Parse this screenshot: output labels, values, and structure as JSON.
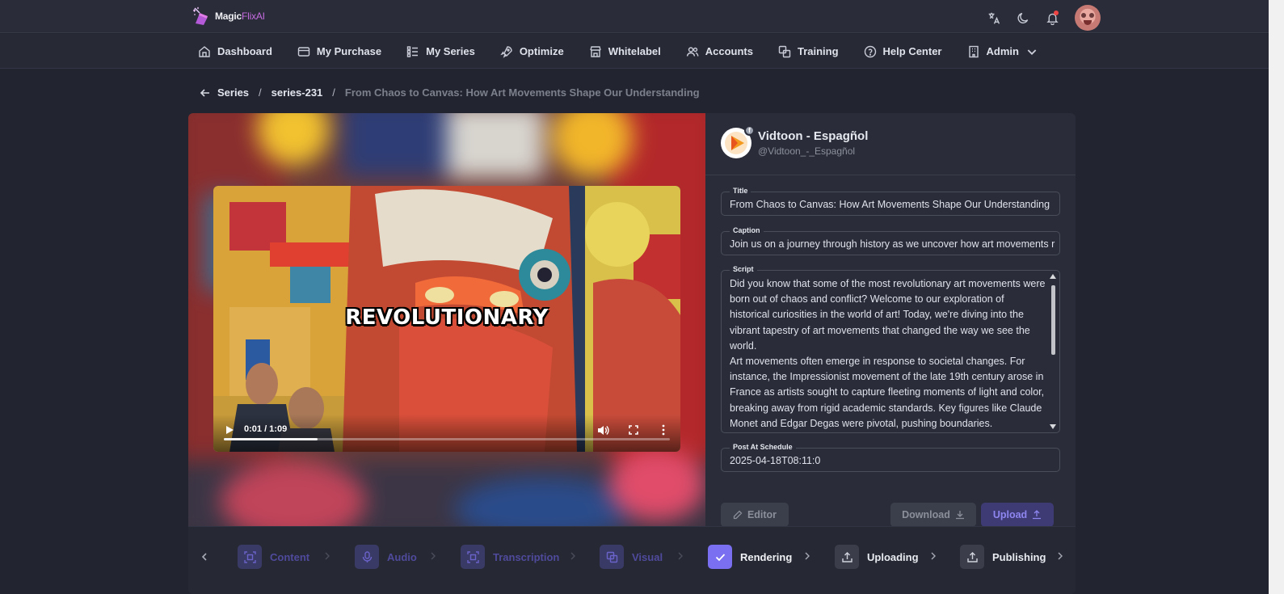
{
  "app": {
    "brand_prefix": "Magic",
    "brand_suffix": "FlixAI"
  },
  "nav": [
    {
      "label": "Dashboard",
      "icon": "home-icon"
    },
    {
      "label": "My Purchase",
      "icon": "credit-card-icon"
    },
    {
      "label": "My Series",
      "icon": "list-icon"
    },
    {
      "label": "Optimize",
      "icon": "rocket-icon"
    },
    {
      "label": "Whitelabel",
      "icon": "store-icon"
    },
    {
      "label": "Accounts",
      "icon": "users-icon"
    },
    {
      "label": "Training",
      "icon": "copy-icon"
    },
    {
      "label": "Help Center",
      "icon": "help-circle-icon"
    },
    {
      "label": "Admin",
      "icon": "building-icon"
    }
  ],
  "breadcrumb": {
    "root": "Series",
    "series": "series-231",
    "current": "From Chaos to Canvas: How Art Movements Shape Our Understanding"
  },
  "video": {
    "overlay_word": "REVOLUTIONARY",
    "time": "0:01 / 1:09",
    "progress": 0.21
  },
  "channel": {
    "name": "Vidtoon - Espagñol",
    "handle": "@Vidtoon_-_Espagñol"
  },
  "form": {
    "title_label": "Title",
    "title_value": "From Chaos to Canvas: How Art Movements Shape Our Understanding",
    "caption_label": "Caption",
    "caption_value": "Join us on a journey through history as we uncover how art movements r",
    "script_label": "Script",
    "script_value": "Did you know that some of the most revolutionary art movements were born out of chaos and conflict? Welcome to our exploration of historical curiosities in the world of art! Today, we're diving into the vibrant tapestry of art movements that changed the way we see the world.\nArt movements often emerge in response to societal changes. For instance, the Impressionist movement of the late 19th century arose in France as artists sought to capture fleeting moments of light and color, breaking away from rigid academic standards. Key figures like Claude Monet and Edgar Degas were pivotal, pushing boundaries.\nMonet focused on daily life, striving to capture the essence of a moment.",
    "schedule_label": "Post At Schedule",
    "schedule_value": "2025-04-18T08:11:0"
  },
  "buttons": {
    "editor": "Editor",
    "download": "Download",
    "upload": "Upload"
  },
  "steps": [
    {
      "label": "Content",
      "state": "done"
    },
    {
      "label": "Audio",
      "state": "done"
    },
    {
      "label": "Transcription",
      "state": "done"
    },
    {
      "label": "Visual",
      "state": "done"
    },
    {
      "label": "Rendering",
      "state": "active"
    },
    {
      "label": "Uploading",
      "state": "pending"
    },
    {
      "label": "Publishing",
      "state": "pending"
    }
  ],
  "colors": {
    "accent": "#7a6ff0",
    "background": "#222530",
    "card": "#2a2d39"
  }
}
